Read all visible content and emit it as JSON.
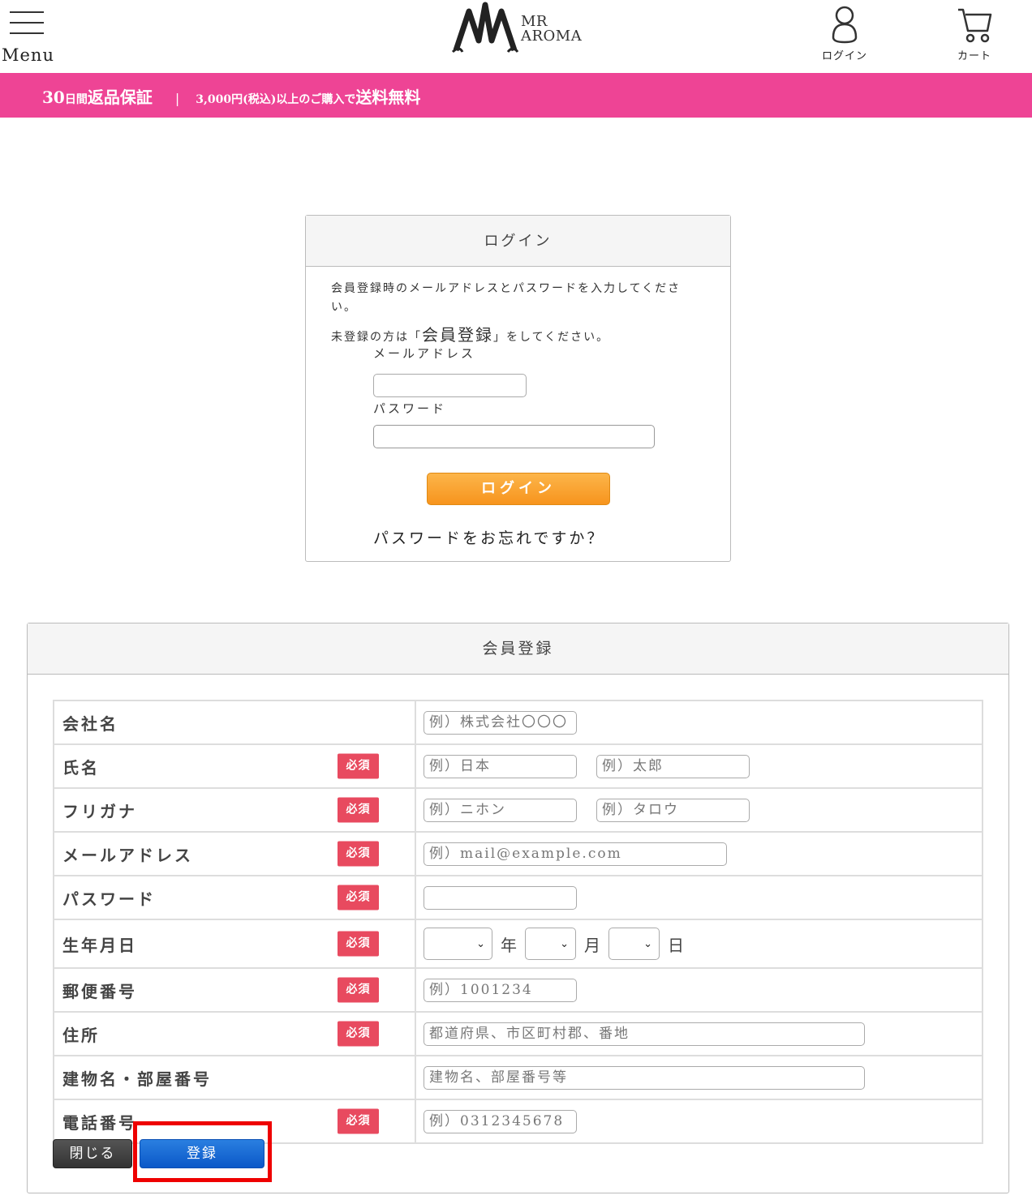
{
  "header": {
    "menu_label": "Menu",
    "logo_line1": "MR",
    "logo_line2": "AROMA",
    "login_label": "ログイン",
    "cart_label": "カート"
  },
  "banner": {
    "days": "30",
    "days_unit": "日間",
    "guarantee": "返品保証",
    "separator": "|",
    "amount": "3,000円(税込)以上のご購入で",
    "free_shipping": "送料無料",
    "color": "#ee4495"
  },
  "login": {
    "title": "ログイン",
    "intro1": "会員登録時のメールアドレスとパスワードを入力してください。",
    "intro2_pre": "未登録の方は「",
    "intro2_link": "会員登録",
    "intro2_post": "」をしてください。",
    "email_label": "メールアドレス",
    "email_value": "",
    "password_label": "パスワード",
    "password_value": "",
    "button": "ログイン",
    "forgot": "パスワードをお忘れですか？"
  },
  "register": {
    "title": "会員登録",
    "required_badge": "必須",
    "rows": [
      {
        "label": "会社名",
        "required": false,
        "placeholders": [
          "例）株式会社〇〇〇"
        ]
      },
      {
        "label": "氏名",
        "required": true,
        "placeholders": [
          "例）日本",
          "例）太郎"
        ]
      },
      {
        "label": "フリガナ",
        "required": true,
        "placeholders": [
          "例）ニホン",
          "例）タロウ"
        ]
      },
      {
        "label": "メールアドレス",
        "required": true,
        "placeholders": [
          "例）mail@example.com"
        ]
      },
      {
        "label": "パスワード",
        "required": true,
        "placeholders": [
          ""
        ]
      },
      {
        "label": "生年月日",
        "required": true,
        "units": [
          "年",
          "月",
          "日"
        ],
        "selected": [
          "",
          "",
          ""
        ]
      },
      {
        "label": "郵便番号",
        "required": true,
        "placeholders": [
          "例）1001234"
        ]
      },
      {
        "label": "住所",
        "required": true,
        "placeholders": [
          "都道府県、市区町村郡、番地"
        ]
      },
      {
        "label": "建物名・部屋番号",
        "required": false,
        "placeholders": [
          "建物名、部屋番号等"
        ]
      },
      {
        "label": "電話番号",
        "required": true,
        "placeholders": [
          "例）0312345678"
        ]
      }
    ],
    "close_button": "閉じる",
    "submit_button": "登録",
    "highlight_color": "#ee0000"
  }
}
